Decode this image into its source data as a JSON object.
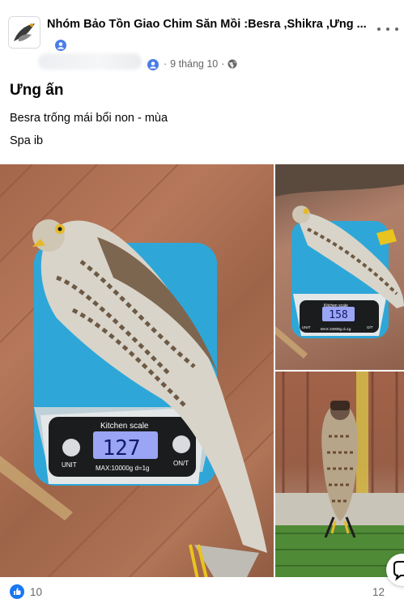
{
  "post": {
    "group_name": "Nhóm Bảo Tồn Giao Chim Săn Mồi :Besra ,Shikra ,Ưng ...",
    "date": "9 tháng 10",
    "separator": "·",
    "title": "Ưng ấn",
    "body_line_1": "Besra trống mái bổi non - mùa",
    "body_line_2": "Spa ib"
  },
  "scale": {
    "brand": "Kitchen scale",
    "reading": "127",
    "unit_label": "UNIT",
    "onoff_label": "ON/T",
    "capacity": "MAX:10000g  d=1g"
  },
  "scale_small": {
    "brand": "Kitchen scale",
    "reading": "158",
    "capacity": "MAX:10000g  d=1g",
    "unit_label": "UNIT",
    "onoff_label": "O/T"
  },
  "reactions": {
    "like_count": "10",
    "comment_count": "12"
  },
  "icons": {
    "more": "more-options-icon",
    "globe": "globe-icon",
    "like": "like-reaction-icon",
    "member": "group-member-icon",
    "chat": "chat-bubble-icon"
  },
  "colors": {
    "accent": "#1877f2",
    "meta": "#65676b",
    "scale_blue": "#2ea7d8"
  }
}
